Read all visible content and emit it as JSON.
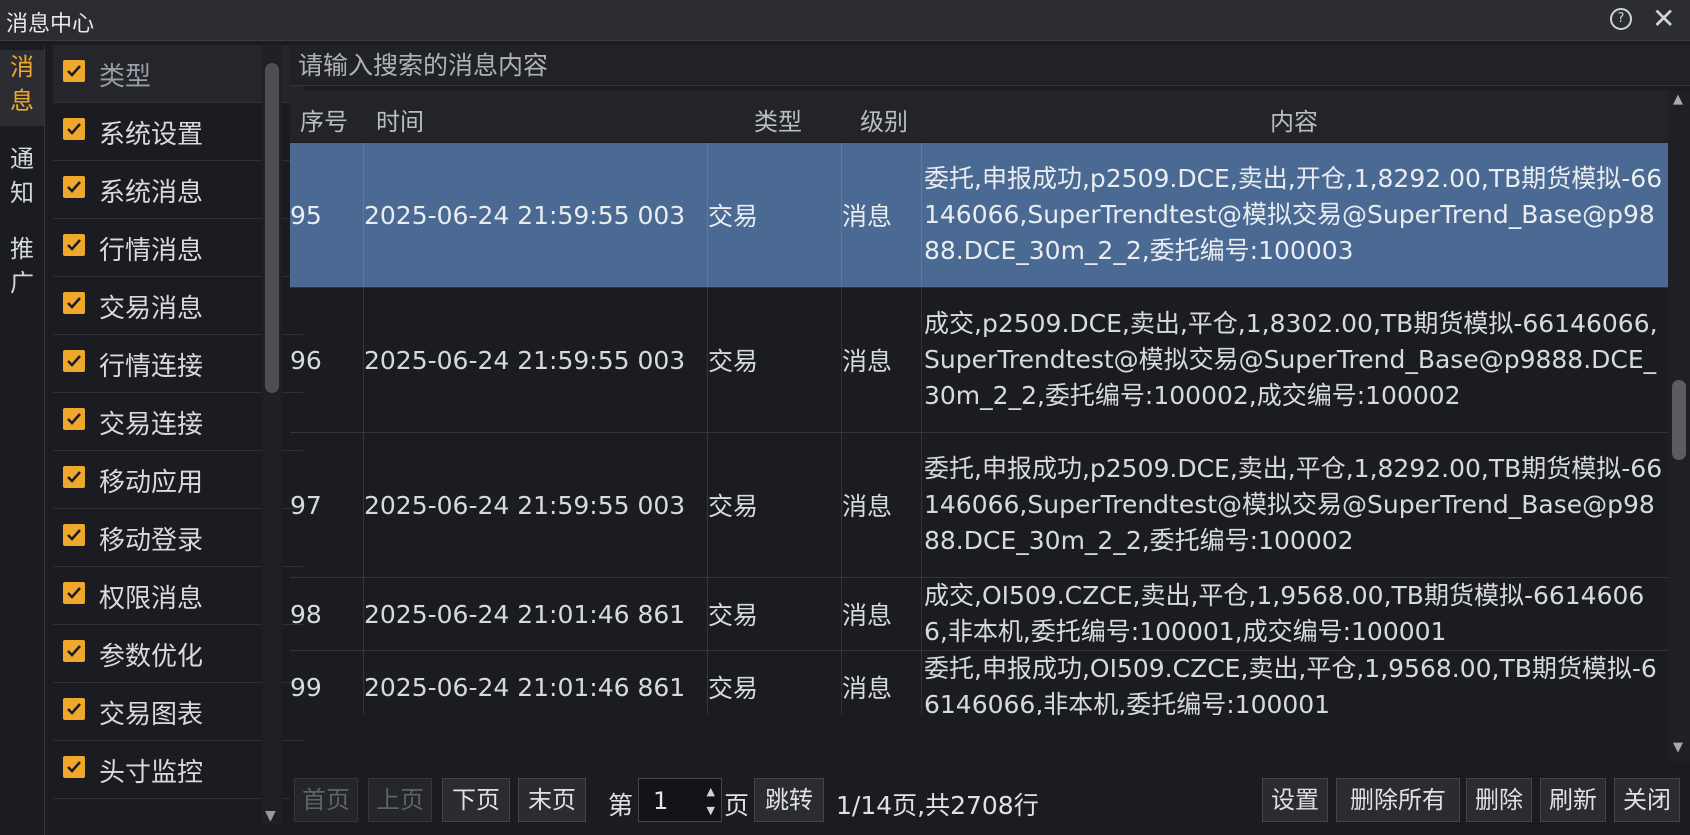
{
  "window": {
    "title": "消息中心",
    "help_icon": "question-circle-icon",
    "close_icon": "close-icon"
  },
  "side_tabs": [
    {
      "label": "消息",
      "chars": [
        "消",
        "息"
      ],
      "active": true
    },
    {
      "label": "通知",
      "chars": [
        "通",
        "知"
      ],
      "active": false
    },
    {
      "label": "推广",
      "chars": [
        "推",
        "广"
      ],
      "active": false
    }
  ],
  "categories": {
    "header": "类型",
    "items": [
      "系统设置",
      "系统消息",
      "行情消息",
      "交易消息",
      "行情连接",
      "交易连接",
      "移动应用",
      "移动登录",
      "权限消息",
      "参数优化",
      "交易图表",
      "头寸监控"
    ]
  },
  "search": {
    "placeholder": "请输入搜索的消息内容"
  },
  "table": {
    "columns": [
      "序号",
      "时间",
      "类型",
      "级别",
      "内容"
    ],
    "rows": [
      {
        "no": "95",
        "time": "2025-06-24 21:59:55 003",
        "type": "交易",
        "level": "消息",
        "content": "委托,申报成功,p2509.DCE,卖出,开仓,1,8292.00,TB期货模拟-66146066,SuperTrendtest@模拟交易@SuperTrend_Base@p9888.DCE_30m_2_2,委托编号:100003",
        "selected": true
      },
      {
        "no": "96",
        "time": "2025-06-24 21:59:55 003",
        "type": "交易",
        "level": "消息",
        "content": "成交,p2509.DCE,卖出,平仓,1,8302.00,TB期货模拟-66146066,SuperTrendtest@模拟交易@SuperTrend_Base@p9888.DCE_30m_2_2,委托编号:100002,成交编号:100002",
        "selected": false
      },
      {
        "no": "97",
        "time": "2025-06-24 21:59:55 003",
        "type": "交易",
        "level": "消息",
        "content": "委托,申报成功,p2509.DCE,卖出,平仓,1,8292.00,TB期货模拟-66146066,SuperTrendtest@模拟交易@SuperTrend_Base@p9888.DCE_30m_2_2,委托编号:100002",
        "selected": false
      },
      {
        "no": "98",
        "time": "2025-06-24 21:01:46 861",
        "type": "交易",
        "level": "消息",
        "content": "成交,OI509.CZCE,卖出,平仓,1,9568.00,TB期货模拟-66146066,非本机,委托编号:100001,成交编号:100001",
        "selected": false
      },
      {
        "no": "99",
        "time": "2025-06-24 21:01:46 861",
        "type": "交易",
        "level": "消息",
        "content": "委托,申报成功,OI509.CZCE,卖出,平仓,1,9568.00,TB期货模拟-66146066,非本机,委托编号:100001",
        "selected": false
      }
    ]
  },
  "pagination": {
    "first": "首页",
    "prev": "上页",
    "next": "下页",
    "last": "末页",
    "page_prefix": "第",
    "page_value": "1",
    "page_suffix": "页",
    "jump": "跳转",
    "summary": "1/14页,共2708行"
  },
  "actions": {
    "settings": "设置",
    "delete_all": "删除所有",
    "delete": "删除",
    "refresh": "刷新",
    "close": "关闭"
  },
  "colors": {
    "accent": "#f0a82c",
    "selected_row": "#4a6a93",
    "background": "#1b1c21"
  }
}
